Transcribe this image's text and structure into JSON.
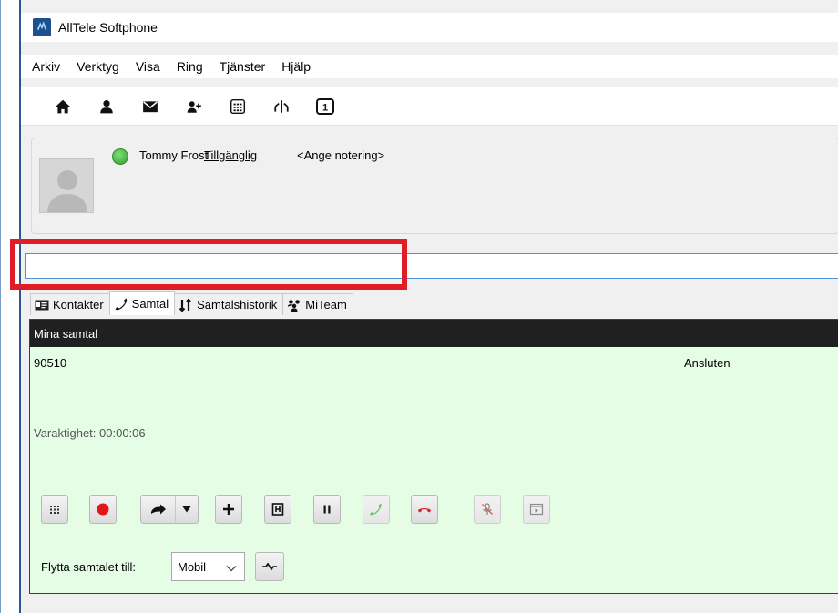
{
  "app": {
    "title": "AllTele Softphone",
    "icon": "alltele-logo-icon"
  },
  "menu": {
    "items": [
      {
        "label": "Arkiv"
      },
      {
        "label": "Verktyg"
      },
      {
        "label": "Visa"
      },
      {
        "label": "Ring"
      },
      {
        "label": "Tjänster"
      },
      {
        "label": "Hjälp"
      }
    ]
  },
  "toolbar": {
    "buttons": [
      {
        "icon": "home-icon"
      },
      {
        "icon": "user-icon"
      },
      {
        "icon": "mail-icon"
      },
      {
        "icon": "add-user-icon"
      },
      {
        "icon": "dialpad-icon"
      },
      {
        "icon": "transfer-split-icon"
      },
      {
        "icon": "line-one-icon",
        "label": "1"
      }
    ]
  },
  "profile": {
    "name": "Tommy Frost",
    "status": "Tillgänglig",
    "note": "<Ange notering>",
    "status_color": "#3aa835"
  },
  "search": {
    "value": "",
    "placeholder": ""
  },
  "tabs": [
    {
      "label": "Kontakter",
      "icon": "contact-card-icon",
      "active": false
    },
    {
      "label": "Samtal",
      "icon": "phone-handset-icon",
      "active": true
    },
    {
      "label": "Samtalshistorik",
      "icon": "call-history-icon",
      "active": false
    },
    {
      "label": "MiTeam",
      "icon": "team-icon",
      "active": false
    }
  ],
  "calls": {
    "header": "Mina samtal",
    "number": "90510",
    "state": "Ansluten",
    "duration": "Varaktighet: 00:00:06",
    "background_color": "#e4fde4",
    "controls": [
      {
        "icon": "dialpad-icon"
      },
      {
        "icon": "record-icon"
      },
      {
        "icon": "forward-arrow-icon"
      },
      {
        "icon": "chevron-down-icon"
      },
      {
        "icon": "plus-icon"
      },
      {
        "icon": "conference-icon"
      },
      {
        "icon": "pause-icon"
      },
      {
        "icon": "answer-phone-icon"
      },
      {
        "icon": "hangup-phone-icon"
      },
      {
        "icon": "mute-mic-icon"
      },
      {
        "icon": "video-window-icon"
      }
    ],
    "transfer": {
      "label": "Flytta samtalet till:",
      "selected": "Mobil",
      "button_icon": "move-call-icon"
    }
  },
  "colors": {
    "accent_frame": "#2b579a",
    "highlight": "#e01d26",
    "record": "#e0161b",
    "hangup": "#d9262a",
    "answer": "#6cc06a"
  }
}
